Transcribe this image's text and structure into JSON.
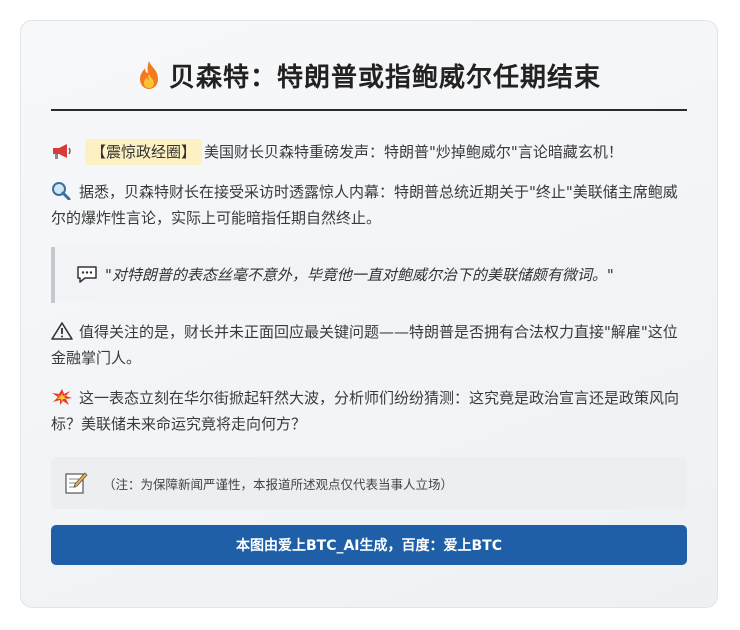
{
  "header": {
    "title": "贝森特：特朗普或指鲍威尔任期结束"
  },
  "paragraph1": {
    "tag": "【震惊政经圈】",
    "text": "美国财长贝森特重磅发声：特朗普\"炒掉鲍威尔\"言论暗藏玄机！"
  },
  "paragraph2": {
    "text": "据悉，贝森特财长在接受采访时透露惊人内幕：特朗普总统近期关于\"终止\"美联储主席鲍威尔的爆炸性言论，实际上可能暗指任期自然终止。"
  },
  "quote": {
    "text": "\"对特朗普的表态丝毫不意外，毕竟他一直对鲍威尔治下的美联储颇有微词。\""
  },
  "paragraph3": {
    "text": "值得关注的是，财长并未正面回应最关键问题——特朗普是否拥有合法权力直接\"解雇\"这位金融掌门人。"
  },
  "paragraph4": {
    "text": "这一表态立刻在华尔街掀起轩然大波，分析师们纷纷猜测：这究竟是政治宣言还是政策风向标？美联储未来命运究竟将走向何方？"
  },
  "note": {
    "text": "（注：为保障新闻严谨性，本报道所述观点仅代表当事人立场）"
  },
  "footer": {
    "label": "本图由爱上BTC_AI生成，百度：爱上BTC"
  },
  "colors": {
    "accent": "#1e5fa8",
    "tag_bg": "#fdf0c2"
  }
}
